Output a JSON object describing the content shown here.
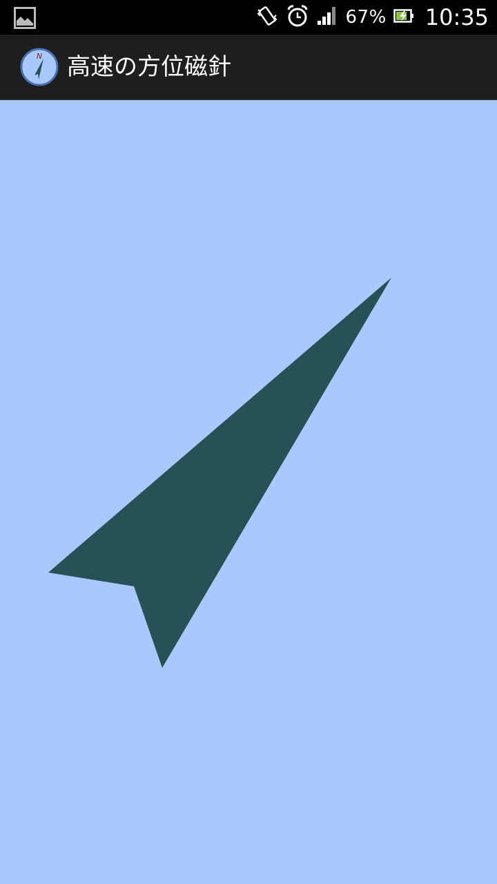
{
  "status_bar": {
    "battery_percent": "67%",
    "time": "10:35",
    "icons": [
      "image-notification-icon",
      "vibrate-icon",
      "alarm-icon",
      "signal-icon",
      "battery-charging-icon"
    ]
  },
  "action_bar": {
    "title": "高速の方位磁針",
    "app_icon_label": "N"
  },
  "compass": {
    "background_color": "#a9c8fc",
    "needle_color": "#265156"
  }
}
